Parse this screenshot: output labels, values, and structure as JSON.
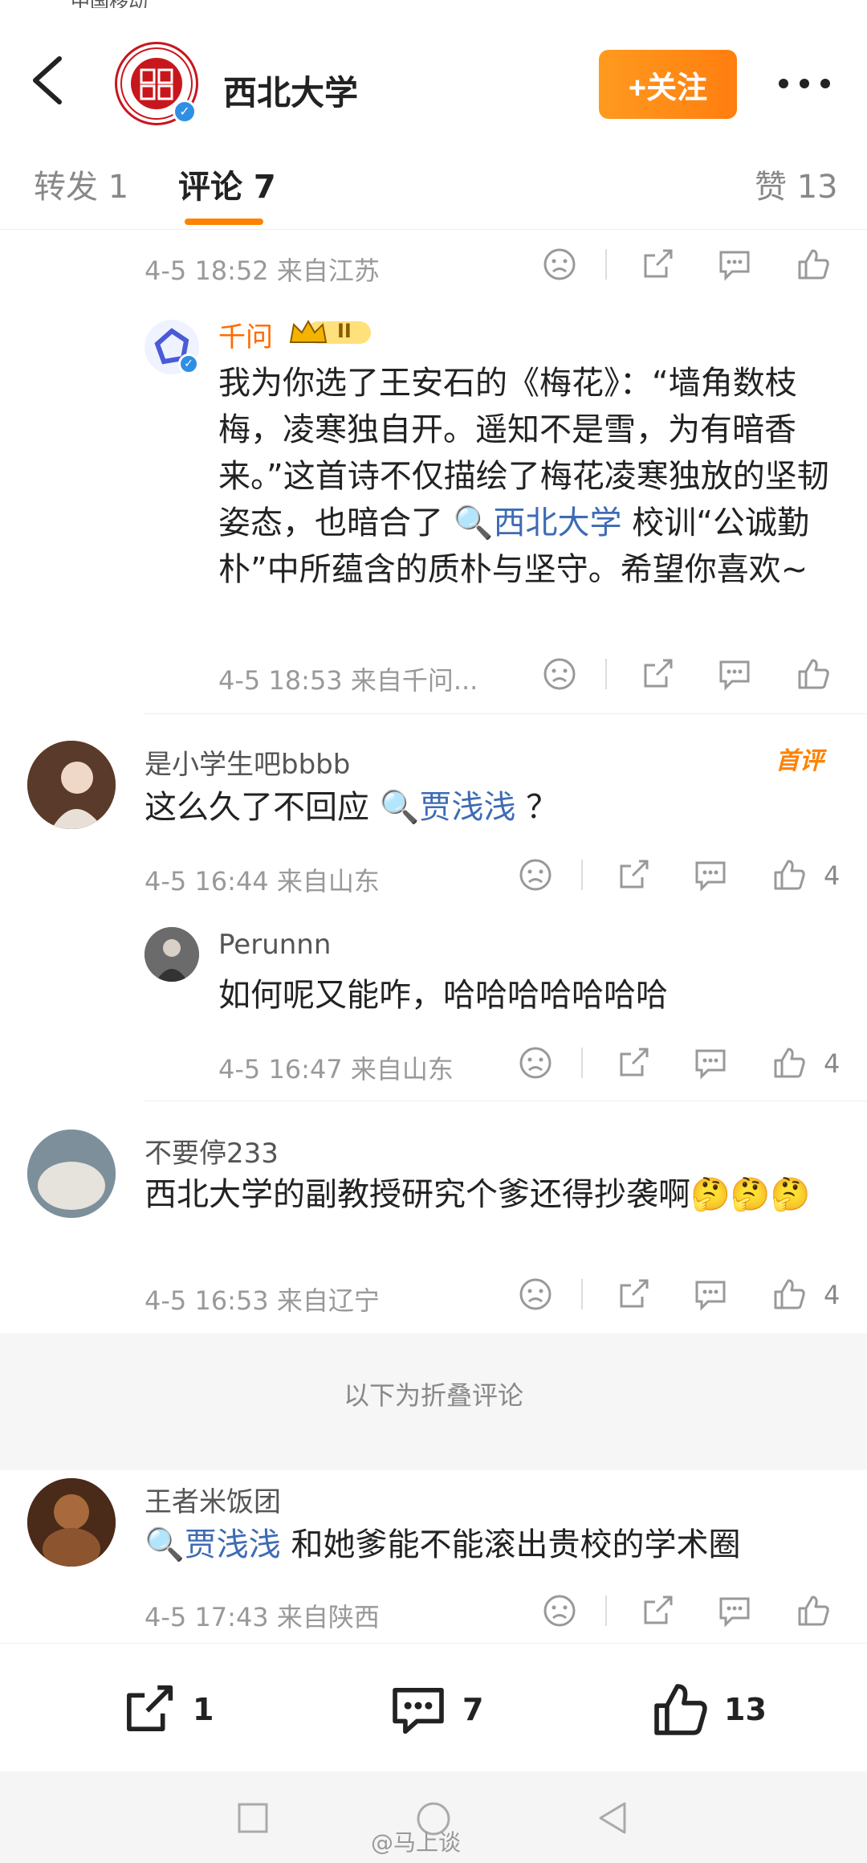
{
  "status": {
    "carrier": "中国移动"
  },
  "header": {
    "title": "西北大学",
    "follow_label": "+关注"
  },
  "tabs": [
    {
      "label": "转发 1"
    },
    {
      "label": "评论 7"
    },
    {
      "label": "赞 13"
    }
  ],
  "comments": {
    "top_meta": "4-5 18:52 来自江苏",
    "reply_qianwen": {
      "user": "千问",
      "badge": "II",
      "text_before": "我为你选了王安石的《梅花》：“墙角数枝梅，凌寒独自开。遥知不是雪，为有暗香来。”这首诗不仅描绘了梅花凌寒独放的坚韧姿态，也暗合了",
      "link": "西北大学",
      "text_after": "校训“公诚勤朴”中所蕴含的质朴与坚守。希望你喜欢~",
      "meta": "4-5 18:53 来自千问..."
    },
    "c1": {
      "user": "是小学生吧bbbb",
      "tag": "首评",
      "text_before": "这么久了不回应",
      "link": "贾浅浅",
      "text_after": "？",
      "meta": "4-5 16:44 来自山东",
      "likes": "4"
    },
    "c1_reply": {
      "user": "Perunnn",
      "text": "如何呢又能咋，哈哈哈哈哈哈哈",
      "meta": "4-5 16:47 来自山东",
      "likes": "4"
    },
    "c2": {
      "user": "不要停233",
      "text": "西北大学的副教授研究个爹还得抄袭啊",
      "emojis": "🤔🤔🤔",
      "meta": "4-5 16:53 来自辽宁",
      "likes": "4"
    },
    "folded_label": "以下为折叠评论",
    "c3": {
      "user": "王者米饭团",
      "link": "贾浅浅",
      "text_after": "和她爹能不能滚出贵校的学术圈",
      "meta": "4-5 17:43 来自陕西"
    }
  },
  "bottombar": {
    "repost": "1",
    "comment": "7",
    "like": "13"
  },
  "watermark": "@马上谈",
  "colors": {
    "accent": "#ff8200",
    "link": "#3e6bb5",
    "brand": "#c8161d"
  }
}
